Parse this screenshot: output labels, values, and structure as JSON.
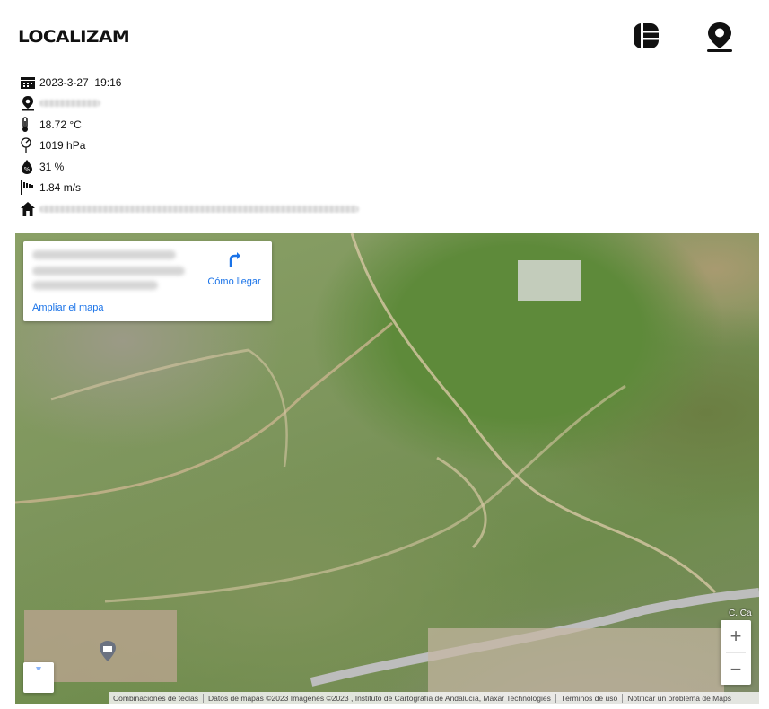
{
  "header": {
    "logo": "LOCALIZAM",
    "menu_icon": "list-menu-icon",
    "location_icon": "map-pin-icon"
  },
  "weather": {
    "date": "2023-3-27",
    "time": "19:16",
    "temperature": "18.72 °C",
    "pressure": "1019 hPa",
    "humidity": "31 %",
    "wind": "1.84 m/s",
    "icons": [
      "calendar-icon",
      "location-pin-icon",
      "thermometer-icon",
      "pressure-icon",
      "humidity-icon",
      "wind-icon",
      "home-icon"
    ]
  },
  "map": {
    "place_card": {
      "directions_label": "Cómo llegar",
      "enlarge_label": "Ampliar el mapa"
    },
    "zoom_in": "+",
    "zoom_out": "−",
    "label_road": "C. Ca",
    "attribution": {
      "shortcuts": "Combinaciones de teclas",
      "data": "Datos de mapas ©2023 Imágenes ©2023 , Instituto de Cartografía de Andalucía, Maxar Technologies",
      "terms": "Términos de uso",
      "report": "Notificar un problema de Maps"
    },
    "colors": {
      "link": "#1a73e8",
      "field_green": "#5e8a3a"
    }
  }
}
